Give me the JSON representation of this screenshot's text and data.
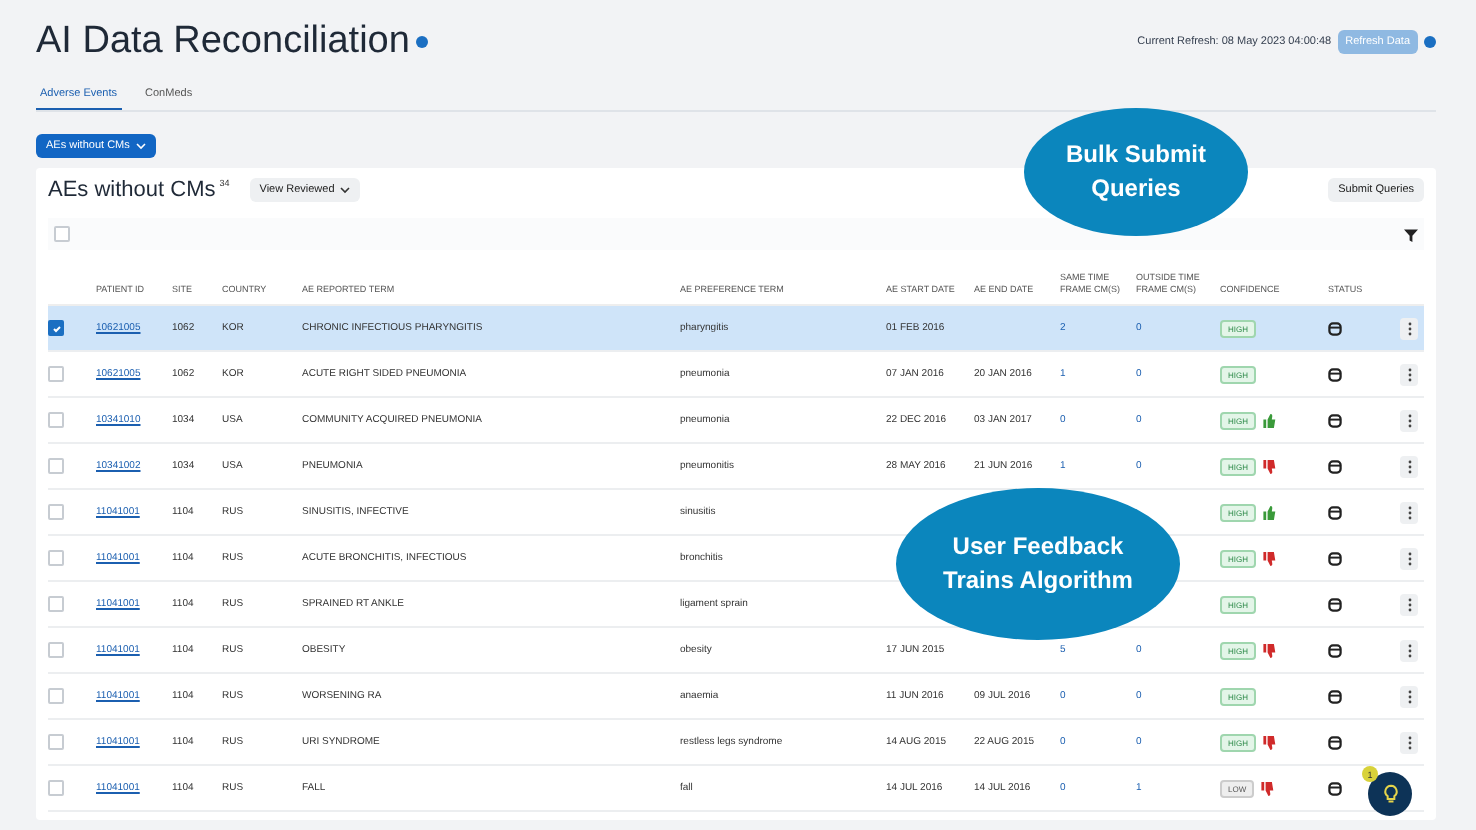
{
  "page": {
    "title": "AI Data Reconciliation",
    "refresh_label": "Current Refresh: 08 May 2023 04:00:48",
    "refresh_button": "Refresh Data"
  },
  "tabs": [
    {
      "label": "Adverse Events",
      "selected": true
    },
    {
      "label": "ConMeds",
      "selected": false
    }
  ],
  "view_dropdown": "AEs without CMs",
  "card": {
    "title": "AEs without CMs",
    "count": "34",
    "filter_dropdown": "View Reviewed",
    "submit_button": "Submit Queries"
  },
  "table": {
    "select_all_checked": false,
    "columns": [
      "PATIENT ID",
      "SITE",
      "COUNTRY",
      "AE REPORTED TERM",
      "AE PREFERENCE TERM",
      "AE START DATE",
      "AE END DATE",
      "SAME TIME FRAME CM(S)",
      "OUTSIDE TIME FRAME CM(S)",
      "CONFIDENCE",
      "STATUS"
    ],
    "rows": [
      {
        "selected": true,
        "patient": "10621005",
        "site": "1062",
        "country": "KOR",
        "term": "CHRONIC INFECTIOUS PHARYNGITIS",
        "pref": "pharyngitis",
        "start": "01 FEB 2016",
        "same": "2",
        "outside": "0",
        "confidence": "HIGH",
        "thumbs_up": false,
        "thumbs_down": false
      },
      {
        "selected": false,
        "patient": "10621005",
        "site": "1062",
        "country": "KOR",
        "term": "ACUTE RIGHT SIDED PNEUMONIA",
        "pref": "pneumonia",
        "start": "07 JAN 2016",
        "end": "20 JAN 2016",
        "same": "1",
        "outside": "0",
        "confidence": "HIGH",
        "thumbs_up": false,
        "thumbs_down": false
      },
      {
        "selected": false,
        "patient": "10341010",
        "site": "1034",
        "country": "USA",
        "term": "COMMUNITY ACQUIRED PNEUMONIA",
        "pref": "pneumonia",
        "start": "22 DEC 2016",
        "end": "03 JAN 2017",
        "same": "0",
        "outside": "0",
        "confidence": "HIGH",
        "thumbs_up": true,
        "thumbs_down": false
      },
      {
        "selected": false,
        "patient": "10341002",
        "site": "1034",
        "country": "USA",
        "term": "PNEUMONIA",
        "pref": "pneumonitis",
        "start": "28 MAY 2016",
        "end": "21 JUN 2016",
        "same": "1",
        "outside": "0",
        "confidence": "HIGH",
        "thumbs_up": false,
        "thumbs_down": true
      },
      {
        "selected": false,
        "patient": "11041001",
        "site": "1104",
        "country": "RUS",
        "term": "SINUSITIS, INFECTIVE",
        "pref": "sinusitis",
        "confidence": "HIGH",
        "thumbs_up": true,
        "thumbs_down": false
      },
      {
        "selected": false,
        "patient": "11041001",
        "site": "1104",
        "country": "RUS",
        "term": "ACUTE BRONCHITIS, INFECTIOUS",
        "pref": "bronchitis",
        "confidence": "HIGH",
        "thumbs_up": false,
        "thumbs_down": true
      },
      {
        "selected": false,
        "patient": "11041001",
        "site": "1104",
        "country": "RUS",
        "term": "SPRAINED RT ANKLE",
        "pref": "ligament sprain",
        "confidence": "HIGH",
        "thumbs_up": false,
        "thumbs_down": false
      },
      {
        "selected": false,
        "patient": "11041001",
        "site": "1104",
        "country": "RUS",
        "term": "OBESITY",
        "pref": "obesity",
        "start": "17 JUN 2015",
        "same": "5",
        "outside": "0",
        "confidence": "HIGH",
        "thumbs_up": false,
        "thumbs_down": true
      },
      {
        "selected": false,
        "patient": "11041001",
        "site": "1104",
        "country": "RUS",
        "term": "WORSENING RA",
        "pref": "anaemia",
        "start": "11 JUN 2016",
        "end": "09 JUL 2016",
        "same": "0",
        "outside": "0",
        "confidence": "HIGH",
        "thumbs_up": false,
        "thumbs_down": false
      },
      {
        "selected": false,
        "patient": "11041001",
        "site": "1104",
        "country": "RUS",
        "term": "URI SYNDROME",
        "pref": "restless legs syndrome",
        "start": "14 AUG 2015",
        "end": "22 AUG 2015",
        "same": "0",
        "outside": "0",
        "confidence": "HIGH",
        "thumbs_up": false,
        "thumbs_down": true
      },
      {
        "selected": false,
        "patient": "11041001",
        "site": "1104",
        "country": "RUS",
        "term": "FALL",
        "pref": "fall",
        "start": "14 JUL 2016",
        "end": "14 JUL 2016",
        "same": "0",
        "outside": "1",
        "confidence": "LOW",
        "thumbs_up": false,
        "thumbs_down": true
      }
    ]
  },
  "callouts": [
    {
      "text": "Bulk Submit Queries"
    },
    {
      "text": "User Feedback Trains Algorithm"
    }
  ],
  "help_button": {
    "badge": "1"
  }
}
